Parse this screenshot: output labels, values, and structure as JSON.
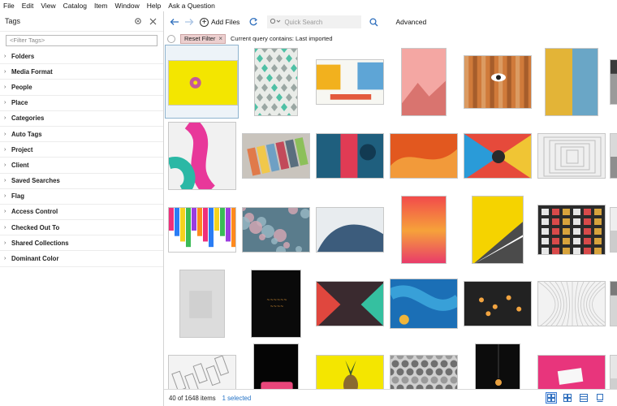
{
  "menu": [
    "File",
    "Edit",
    "View",
    "Catalog",
    "Item",
    "Window",
    "Help",
    "Ask a Question"
  ],
  "sidebar": {
    "title": "Tags",
    "filter_placeholder": "<Filter Tags>",
    "items": [
      "Folders",
      "Media Format",
      "People",
      "Place",
      "Categories",
      "Auto Tags",
      "Project",
      "Client",
      "Saved Searches",
      "Flag",
      "Access Control",
      "Checked Out To",
      "Shared Collections",
      "Dominant Color"
    ]
  },
  "toolbar": {
    "add_files": "Add Files",
    "search_placeholder": "Quick Search",
    "advanced": "Advanced"
  },
  "query": {
    "reset_label": "Reset Filter",
    "text": "Current query contains: Last imported"
  },
  "status": {
    "count": "40 of 1648 items",
    "selected": "1 selected"
  },
  "thumbnails": [
    {
      "name": "yellow-donut",
      "kind": "yellow-donut",
      "colors": [
        "#f3e600",
        "#c45a9a"
      ]
    },
    {
      "name": "teal-diamonds",
      "kind": "diamonds",
      "colors": [
        "#e9ece8",
        "#4fc0a5",
        "#9aa7a3"
      ]
    },
    {
      "name": "colorful-street",
      "kind": "street",
      "colors": [
        "#f7f7f2",
        "#5ea5d6",
        "#f2b11e",
        "#e35a3c"
      ]
    },
    {
      "name": "pink-mountains",
      "kind": "pink",
      "colors": [
        "#f4a7a3",
        "#d9746f"
      ]
    },
    {
      "name": "wood-eye-graffiti",
      "kind": "wood",
      "colors": [
        "#d07a3a",
        "#8a4a22",
        "#e2b17d"
      ]
    },
    {
      "name": "yellow-blue-wall",
      "kind": "split",
      "colors": [
        "#e3b437",
        "#6aa6c6"
      ]
    },
    {
      "name": "dark-edge",
      "kind": "dark",
      "colors": [
        "#3b3b3b",
        "#9a9a9a"
      ]
    },
    {
      "name": "fluid-paint",
      "kind": "fluid",
      "colors": [
        "#f1f1f1",
        "#e8389a",
        "#2bb8a5"
      ]
    },
    {
      "name": "swatch-books",
      "kind": "swatches",
      "colors": [
        "#c9c4bd",
        "#5a6e7e",
        "#e07a4a"
      ]
    },
    {
      "name": "blue-red-abstract",
      "kind": "bluered",
      "colors": [
        "#1f5f7e",
        "#e03b54"
      ]
    },
    {
      "name": "orange-wave",
      "kind": "orange",
      "colors": [
        "#e2581f",
        "#f29a3a"
      ]
    },
    {
      "name": "geometric-face",
      "kind": "geo",
      "colors": [
        "#e64a3b",
        "#2a9bd8",
        "#f0c534"
      ]
    },
    {
      "name": "white-tunnel",
      "kind": "tunnel",
      "colors": [
        "#efefef",
        "#bdbdbd"
      ]
    },
    {
      "name": "gray-edge",
      "kind": "gray",
      "colors": [
        "#d9d9d9",
        "#8e8e8e"
      ]
    },
    {
      "name": "paint-drips",
      "kind": "drips",
      "colors": [
        "#ef2f7a",
        "#2a7df5",
        "#f6d21e",
        "#3bbb57"
      ]
    },
    {
      "name": "bokeh-lights",
      "kind": "bokeh",
      "colors": [
        "#9ab9c6",
        "#d7a8b4",
        "#5a7c8c"
      ]
    },
    {
      "name": "blue-curve",
      "kind": "curve",
      "colors": [
        "#e8ecef",
        "#3c5c7c"
      ]
    },
    {
      "name": "orange-pink-gradient",
      "kind": "gradient",
      "colors": [
        "#f24b4b",
        "#f6a23a",
        "#e8366c"
      ]
    },
    {
      "name": "yellow-gray-triangle",
      "kind": "triangle",
      "colors": [
        "#f5d300",
        "#4b4b4b"
      ]
    },
    {
      "name": "photo-wall",
      "kind": "photowall",
      "colors": [
        "#2b2b2b",
        "#d94a4a",
        "#d7a33c"
      ]
    },
    {
      "name": "white-edge",
      "kind": "light",
      "colors": [
        "#eeeeee",
        "#cccccc"
      ]
    },
    {
      "name": "gray-texture",
      "kind": "texture",
      "colors": [
        "#dcdcdc",
        "#c4c4c4"
      ]
    },
    {
      "name": "neon-sign",
      "kind": "neon",
      "colors": [
        "#0a0a0a",
        "#f1a23a"
      ]
    },
    {
      "name": "music-neon",
      "kind": "music",
      "colors": [
        "#3a2a2f",
        "#e0473e",
        "#35c0a0"
      ]
    },
    {
      "name": "blue-paint",
      "kind": "bluepaint",
      "colors": [
        "#1b6fb6",
        "#38a0d8",
        "#f0b53a"
      ]
    },
    {
      "name": "hanging-bulbs",
      "kind": "bulbs",
      "colors": [
        "#222222",
        "#f2a440"
      ]
    },
    {
      "name": "white-ribs",
      "kind": "ribs",
      "colors": [
        "#f2f2f2",
        "#c8c8c8"
      ]
    },
    {
      "name": "dark-edge-2",
      "kind": "dark",
      "colors": [
        "#7a7a7a",
        "#d5d5d5"
      ]
    },
    {
      "name": "wireframe-sketch",
      "kind": "sketch",
      "colors": [
        "#f3f3f3",
        "#9a9a9a"
      ]
    },
    {
      "name": "pink-car",
      "kind": "pinkcar",
      "colors": [
        "#050505",
        "#e8467a"
      ]
    },
    {
      "name": "pineapple",
      "kind": "pineapple",
      "colors": [
        "#f4e600",
        "#3a5a2a"
      ]
    },
    {
      "name": "hex-tiles",
      "kind": "hex",
      "colors": [
        "#6f6f6f",
        "#cfcfcf"
      ]
    },
    {
      "name": "single-bulb",
      "kind": "bulb",
      "colors": [
        "#0c0c0c",
        "#e8a040"
      ]
    },
    {
      "name": "pink-note",
      "kind": "pinknote",
      "colors": [
        "#e8357c",
        "#f7f7f7"
      ]
    },
    {
      "name": "edge-5",
      "kind": "light",
      "colors": [
        "#e6e6e6",
        "#cfcfcf"
      ]
    }
  ]
}
